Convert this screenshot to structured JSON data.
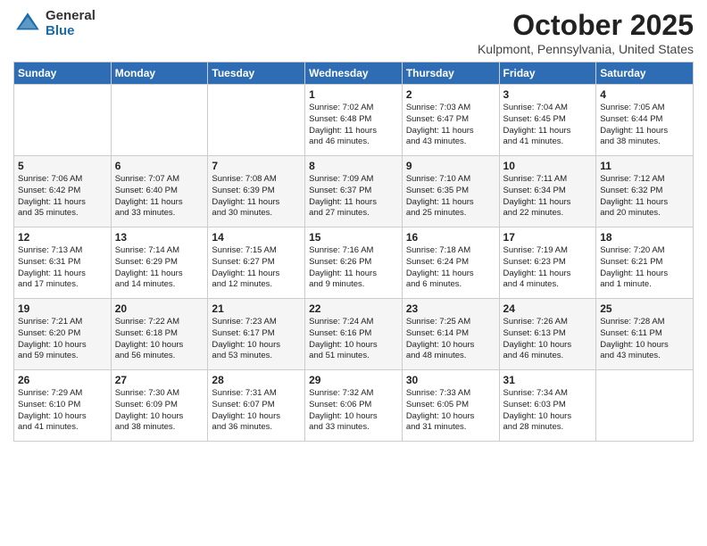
{
  "logo": {
    "general": "General",
    "blue": "Blue"
  },
  "title": "October 2025",
  "subtitle": "Kulpmont, Pennsylvania, United States",
  "headers": [
    "Sunday",
    "Monday",
    "Tuesday",
    "Wednesday",
    "Thursday",
    "Friday",
    "Saturday"
  ],
  "rows": [
    [
      {
        "num": "",
        "info": ""
      },
      {
        "num": "",
        "info": ""
      },
      {
        "num": "",
        "info": ""
      },
      {
        "num": "1",
        "info": "Sunrise: 7:02 AM\nSunset: 6:48 PM\nDaylight: 11 hours\nand 46 minutes."
      },
      {
        "num": "2",
        "info": "Sunrise: 7:03 AM\nSunset: 6:47 PM\nDaylight: 11 hours\nand 43 minutes."
      },
      {
        "num": "3",
        "info": "Sunrise: 7:04 AM\nSunset: 6:45 PM\nDaylight: 11 hours\nand 41 minutes."
      },
      {
        "num": "4",
        "info": "Sunrise: 7:05 AM\nSunset: 6:44 PM\nDaylight: 11 hours\nand 38 minutes."
      }
    ],
    [
      {
        "num": "5",
        "info": "Sunrise: 7:06 AM\nSunset: 6:42 PM\nDaylight: 11 hours\nand 35 minutes."
      },
      {
        "num": "6",
        "info": "Sunrise: 7:07 AM\nSunset: 6:40 PM\nDaylight: 11 hours\nand 33 minutes."
      },
      {
        "num": "7",
        "info": "Sunrise: 7:08 AM\nSunset: 6:39 PM\nDaylight: 11 hours\nand 30 minutes."
      },
      {
        "num": "8",
        "info": "Sunrise: 7:09 AM\nSunset: 6:37 PM\nDaylight: 11 hours\nand 27 minutes."
      },
      {
        "num": "9",
        "info": "Sunrise: 7:10 AM\nSunset: 6:35 PM\nDaylight: 11 hours\nand 25 minutes."
      },
      {
        "num": "10",
        "info": "Sunrise: 7:11 AM\nSunset: 6:34 PM\nDaylight: 11 hours\nand 22 minutes."
      },
      {
        "num": "11",
        "info": "Sunrise: 7:12 AM\nSunset: 6:32 PM\nDaylight: 11 hours\nand 20 minutes."
      }
    ],
    [
      {
        "num": "12",
        "info": "Sunrise: 7:13 AM\nSunset: 6:31 PM\nDaylight: 11 hours\nand 17 minutes."
      },
      {
        "num": "13",
        "info": "Sunrise: 7:14 AM\nSunset: 6:29 PM\nDaylight: 11 hours\nand 14 minutes."
      },
      {
        "num": "14",
        "info": "Sunrise: 7:15 AM\nSunset: 6:27 PM\nDaylight: 11 hours\nand 12 minutes."
      },
      {
        "num": "15",
        "info": "Sunrise: 7:16 AM\nSunset: 6:26 PM\nDaylight: 11 hours\nand 9 minutes."
      },
      {
        "num": "16",
        "info": "Sunrise: 7:18 AM\nSunset: 6:24 PM\nDaylight: 11 hours\nand 6 minutes."
      },
      {
        "num": "17",
        "info": "Sunrise: 7:19 AM\nSunset: 6:23 PM\nDaylight: 11 hours\nand 4 minutes."
      },
      {
        "num": "18",
        "info": "Sunrise: 7:20 AM\nSunset: 6:21 PM\nDaylight: 11 hours\nand 1 minute."
      }
    ],
    [
      {
        "num": "19",
        "info": "Sunrise: 7:21 AM\nSunset: 6:20 PM\nDaylight: 10 hours\nand 59 minutes."
      },
      {
        "num": "20",
        "info": "Sunrise: 7:22 AM\nSunset: 6:18 PM\nDaylight: 10 hours\nand 56 minutes."
      },
      {
        "num": "21",
        "info": "Sunrise: 7:23 AM\nSunset: 6:17 PM\nDaylight: 10 hours\nand 53 minutes."
      },
      {
        "num": "22",
        "info": "Sunrise: 7:24 AM\nSunset: 6:16 PM\nDaylight: 10 hours\nand 51 minutes."
      },
      {
        "num": "23",
        "info": "Sunrise: 7:25 AM\nSunset: 6:14 PM\nDaylight: 10 hours\nand 48 minutes."
      },
      {
        "num": "24",
        "info": "Sunrise: 7:26 AM\nSunset: 6:13 PM\nDaylight: 10 hours\nand 46 minutes."
      },
      {
        "num": "25",
        "info": "Sunrise: 7:28 AM\nSunset: 6:11 PM\nDaylight: 10 hours\nand 43 minutes."
      }
    ],
    [
      {
        "num": "26",
        "info": "Sunrise: 7:29 AM\nSunset: 6:10 PM\nDaylight: 10 hours\nand 41 minutes."
      },
      {
        "num": "27",
        "info": "Sunrise: 7:30 AM\nSunset: 6:09 PM\nDaylight: 10 hours\nand 38 minutes."
      },
      {
        "num": "28",
        "info": "Sunrise: 7:31 AM\nSunset: 6:07 PM\nDaylight: 10 hours\nand 36 minutes."
      },
      {
        "num": "29",
        "info": "Sunrise: 7:32 AM\nSunset: 6:06 PM\nDaylight: 10 hours\nand 33 minutes."
      },
      {
        "num": "30",
        "info": "Sunrise: 7:33 AM\nSunset: 6:05 PM\nDaylight: 10 hours\nand 31 minutes."
      },
      {
        "num": "31",
        "info": "Sunrise: 7:34 AM\nSunset: 6:03 PM\nDaylight: 10 hours\nand 28 minutes."
      },
      {
        "num": "",
        "info": ""
      }
    ]
  ]
}
